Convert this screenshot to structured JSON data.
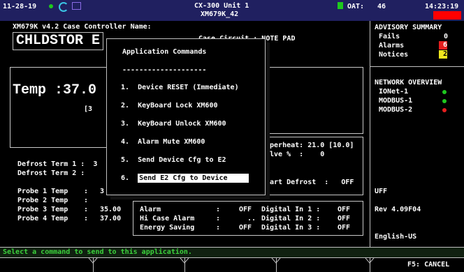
{
  "topbar": {
    "date": "11-28-19",
    "unit_title": "CX-300 Unit 1",
    "unit_subtitle": "XM679K_42",
    "oat_label": "OAT:",
    "oat_value": "46",
    "time": "14:23:19"
  },
  "controller": {
    "header": "XM679K v4.2 Case Controller Name:",
    "name": "CHLDSTOR E",
    "circuit_label": "Case Circuit : NOTE PAD",
    "temp_label": "Temp :37.0",
    "bracket_value": "[3",
    "defrost_term1": "Defrost Term 1 :  3",
    "defrost_term2": "Defrost Term 2 :",
    "superheat": "uperheat: 21.0 [10.0]",
    "valve": "alve %  :    0",
    "start_defrost": "tart Defrost  :   OFF",
    "probes": [
      {
        "label": "Probe 1 Temp",
        "value": "3"
      },
      {
        "label": "Probe 2 Temp",
        "value": ""
      },
      {
        "label": "Probe 3 Temp",
        "value": "35.00"
      },
      {
        "label": "Probe 4 Temp",
        "value": "37.00"
      }
    ],
    "alarm_rows": [
      {
        "label": "Alarm",
        "value": "OFF",
        "din_label": "Digital In 1 :",
        "din_value": "OFF"
      },
      {
        "label": "Hi Case Alarm",
        "value": "..",
        "din_label": "Digital In 2 :",
        "din_value": "OFF"
      },
      {
        "label": "Energy Saving",
        "value": "OFF",
        "din_label": "Digital In 3 :",
        "din_value": "OFF"
      }
    ]
  },
  "advisory": {
    "title": "ADVISORY SUMMARY",
    "fails_label": "Fails",
    "fails_value": "0",
    "alarms_label": "Alarms",
    "alarms_value": "6",
    "notices_label": "Notices",
    "notices_value": "2"
  },
  "network": {
    "title": "NETWORK OVERVIEW",
    "items": [
      {
        "label": "IONet-1",
        "status_color": "#1ec81e"
      },
      {
        "label": "MODBUS-1",
        "status_color": "#1ec81e"
      },
      {
        "label": "MODBUS-2",
        "status_color": "#e61e1e"
      }
    ]
  },
  "side_info": {
    "uff": "UFF",
    "rev": "Rev 4.09F04",
    "locale": "English-US"
  },
  "dialog": {
    "title": "Application Commands",
    "separator": "--------------------",
    "commands": [
      {
        "num": "1.",
        "label": "Device RESET (Immediate)"
      },
      {
        "num": "2.",
        "label": "KeyBoard Lock XM600"
      },
      {
        "num": "3.",
        "label": "KeyBoard Unlock XM600"
      },
      {
        "num": "4.",
        "label": "Alarm Mute XM600"
      },
      {
        "num": "5.",
        "label": "Send Device Cfg to E2"
      },
      {
        "num": "6.",
        "label": "Send E2 Cfg to Device"
      }
    ],
    "selected_index": 6
  },
  "status": {
    "message": "Select a command to send to this application."
  },
  "footer": {
    "f5_label": "F5: CANCEL"
  },
  "colors": {
    "alarm_badge": "#e61e1e",
    "notice_badge": "#f0e61e",
    "alert_box": "#ff0000"
  }
}
